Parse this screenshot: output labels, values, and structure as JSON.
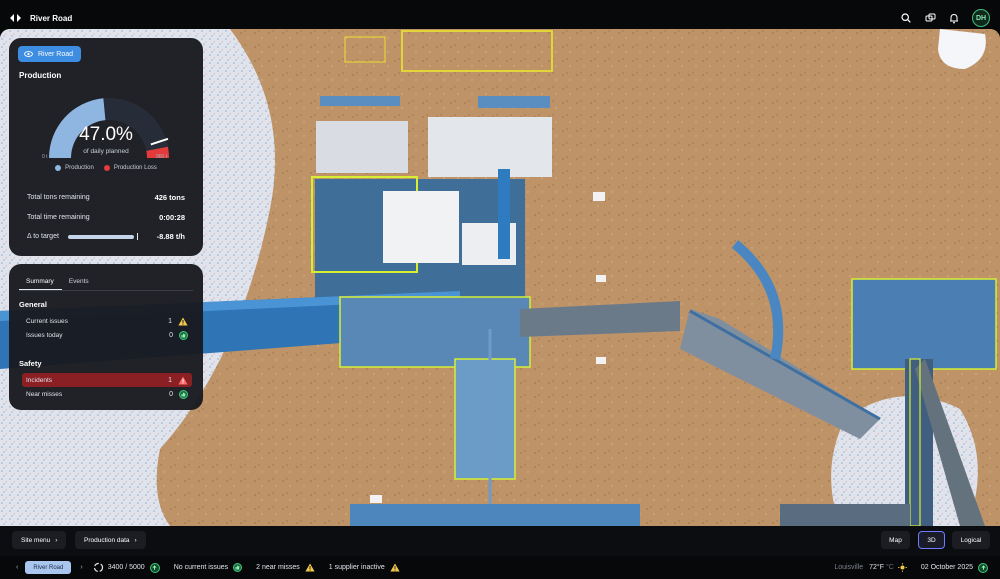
{
  "app": {
    "site_title": "River Road",
    "user_initials": "DH"
  },
  "production": {
    "site_chip": "River Road",
    "title": "Production",
    "percent_text": "47.0%",
    "percent_value": 47.0,
    "percent_caption": "of daily planned",
    "loss_fraction": 0.06,
    "scale_min": "0 t",
    "scale_max": "960 t",
    "legend": [
      {
        "label": "Production",
        "color": "#8fb6e0"
      },
      {
        "label": "Production Loss",
        "color": "#e23b3b"
      }
    ],
    "stats": [
      {
        "label": "Total tons remaining",
        "value": "426 tons"
      },
      {
        "label": "Total time remaining",
        "value": "0:00:28"
      },
      {
        "label": "Δ to target",
        "value": "-8.88 t/h"
      }
    ]
  },
  "summary": {
    "tabs": [
      "Summary",
      "Events"
    ],
    "general_title": "General",
    "general": [
      {
        "label": "Current issues",
        "count": "1",
        "icon": "warning-icon"
      },
      {
        "label": "Issues today",
        "count": "0",
        "icon": "thumbs-up-icon"
      }
    ],
    "safety_title": "Safety",
    "safety": [
      {
        "label": "Incidents",
        "count": "1",
        "icon": "warning-icon"
      },
      {
        "label": "Near misses",
        "count": "0",
        "icon": "thumbs-up-icon"
      }
    ]
  },
  "bottom": {
    "site_menu": "Site menu",
    "production_data": "Production data",
    "views": [
      "Map",
      "3D",
      "Logical"
    ],
    "selected_view": "3D"
  },
  "statusbar": {
    "site": "River Road",
    "throughput": "3400 / 5000",
    "issues": "No current issues",
    "near_misses": "2 near misses",
    "supplier": "1 supplier inactive",
    "city": "Louisville",
    "temp": "72°F",
    "temp_unit": "°C",
    "date": "02 October 2025"
  },
  "colors": {
    "accent": "#3d8de2",
    "production": "#8fb6e0",
    "loss": "#e23b3b",
    "ok": "#3ec77d",
    "warning": "#f2c94c"
  }
}
